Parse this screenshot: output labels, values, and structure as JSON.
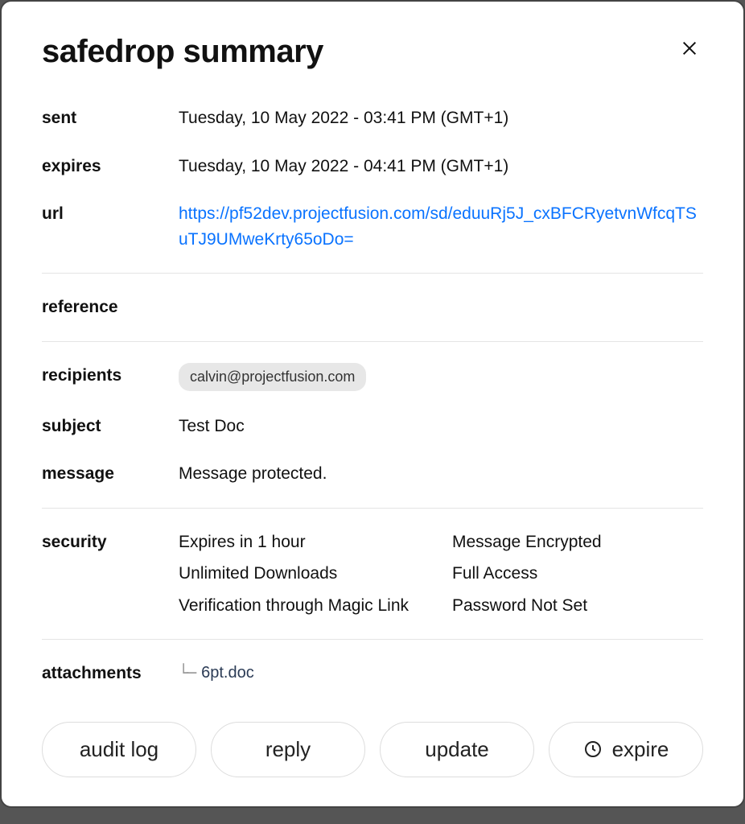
{
  "title": "safedrop summary",
  "labels": {
    "sent": "sent",
    "expires": "expires",
    "url": "url",
    "reference": "reference",
    "recipients": "recipients",
    "subject": "subject",
    "message": "message",
    "security": "security",
    "attachments": "attachments"
  },
  "sent": "Tuesday, 10 May 2022 - 03:41 PM (GMT+1)",
  "expires": "Tuesday, 10 May 2022 - 04:41 PM (GMT+1)",
  "url": "https://pf52dev.projectfusion.com/sd/eduuRj5J_cxBFCRyetvnWfcqTSuTJ9UMweKrty65oDo=",
  "reference": "",
  "recipients": [
    "calvin@projectfusion.com"
  ],
  "subject": "Test Doc",
  "message": "Message protected.",
  "security": {
    "col1": [
      "Expires in 1 hour",
      "Unlimited Downloads",
      "Verification through Magic Link"
    ],
    "col2": [
      "Message Encrypted",
      "Full Access",
      "Password Not Set"
    ]
  },
  "attachments": [
    "6pt.doc"
  ],
  "actions": {
    "audit_log": "audit log",
    "reply": "reply",
    "update": "update",
    "expire": "expire"
  }
}
